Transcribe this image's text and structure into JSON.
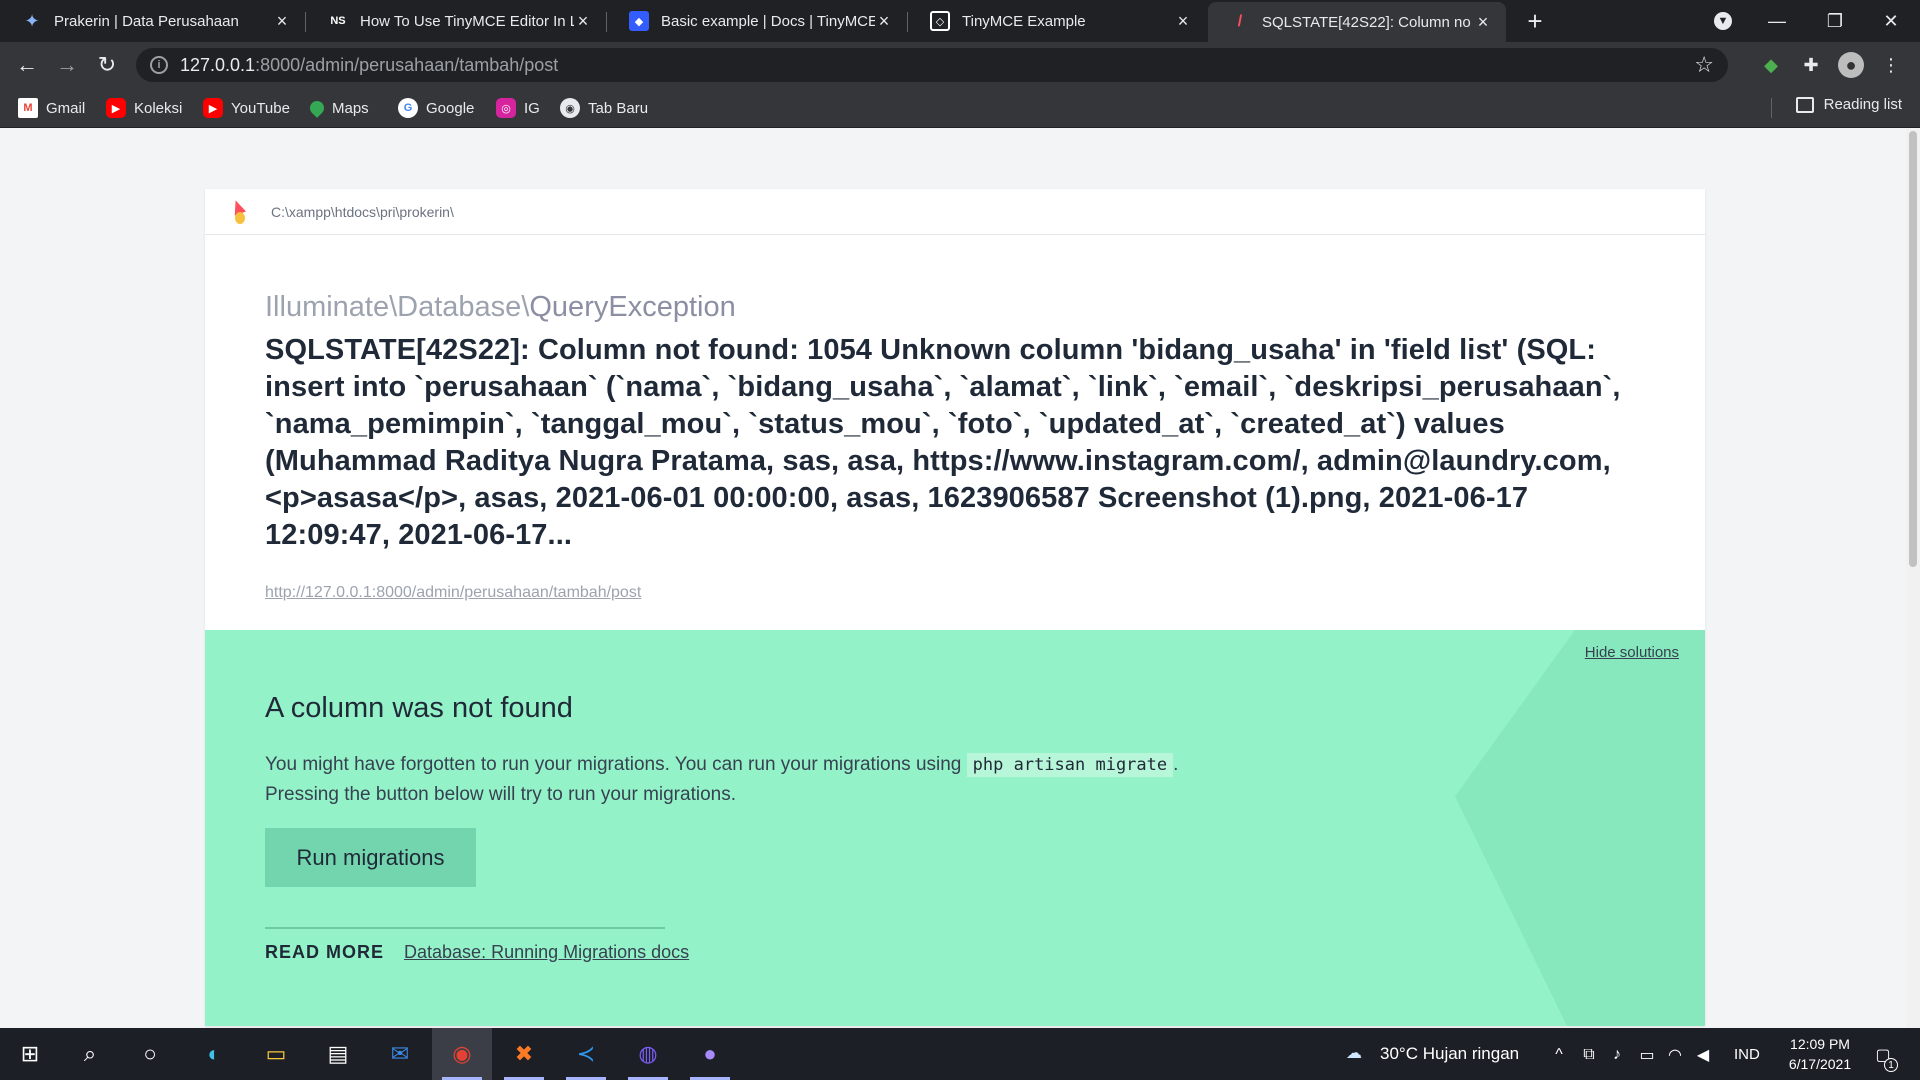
{
  "browser": {
    "tabs": [
      {
        "title": "Prakerin | Data Perusahaan",
        "favicon": "bird",
        "active": false
      },
      {
        "title": "How To Use TinyMCE Editor In La",
        "favicon": "NS",
        "active": false
      },
      {
        "title": "Basic example | Docs | TinyMCE",
        "favicon": "tinymce-docs",
        "active": false
      },
      {
        "title": "TinyMCE Example",
        "favicon": "tinymce",
        "active": false
      },
      {
        "title": "SQLSTATE[42S22]: Column no",
        "favicon": "ignition",
        "active": true
      }
    ],
    "address": {
      "host": "127.0.0.1",
      "rest": ":8000/admin/perusahaan/tambah/post"
    },
    "bookmarks": [
      {
        "label": "Gmail",
        "icon": "gmail-icon",
        "color": "#ea4335"
      },
      {
        "label": "Koleksi",
        "icon": "youtube-icon",
        "color": "#ff0000"
      },
      {
        "label": "YouTube",
        "icon": "youtube-icon",
        "color": "#ff0000"
      },
      {
        "label": "Maps",
        "icon": "maps-icon",
        "color": "#34a853"
      },
      {
        "label": "Google",
        "icon": "google-icon",
        "color": "#4285f4"
      },
      {
        "label": "IG",
        "icon": "instagram-icon",
        "color": "#d6249f"
      },
      {
        "label": "Tab Baru",
        "icon": "globe-icon",
        "color": "#9aa0a6"
      }
    ],
    "reading_list": "Reading list"
  },
  "page": {
    "app_path": "C:\\xampp\\htdocs\\pri\\prokerin\\",
    "exception_namespace": "Illuminate\\Database\\",
    "exception_class": "QueryException",
    "message": "SQLSTATE[42S22]: Column not found: 1054 Unknown column 'bidang_usaha' in 'field list' (SQL: insert into `perusahaan` (`nama`, `bidang_usaha`, `alamat`, `link`, `email`, `deskripsi_perusahaan`, `nama_pemimpin`, `tanggal_mou`, `status_mou`, `foto`, `updated_at`, `created_at`) values (Muhammad Raditya Nugra Pratama, sas, asa, https://www.instagram.com/, admin@laundry.com, <p>asasa</p>, asas, 2021-06-01 00:00:00, asas, 1623906587 Screenshot (1).png, 2021-06-17 12:09:47, 2021-06-17...",
    "request_url": "http://127.0.0.1:8000/admin/perusahaan/tambah/post",
    "solution": {
      "hide_label": "Hide solutions",
      "title": "A column was not found",
      "text_before": "You might have forgotten to run your migrations. You can run your migrations using ",
      "code": "php artisan migrate",
      "text_after": ".",
      "text_line2": "Pressing the button below will try to run your migrations.",
      "button_label": "Run migrations",
      "read_more_label": "READ MORE",
      "read_more_link": "Database: Running Migrations docs"
    }
  },
  "taskbar": {
    "weather": "30°C  Hujan ringan",
    "language": "IND",
    "time": "12:09 PM",
    "date": "6/17/2021",
    "notification_count": "1"
  },
  "colors": {
    "solution_bg": "#94f2c8",
    "button_bg": "#73d5ad",
    "chrome_dark": "#202124",
    "chrome_toolbar": "#35363a"
  }
}
